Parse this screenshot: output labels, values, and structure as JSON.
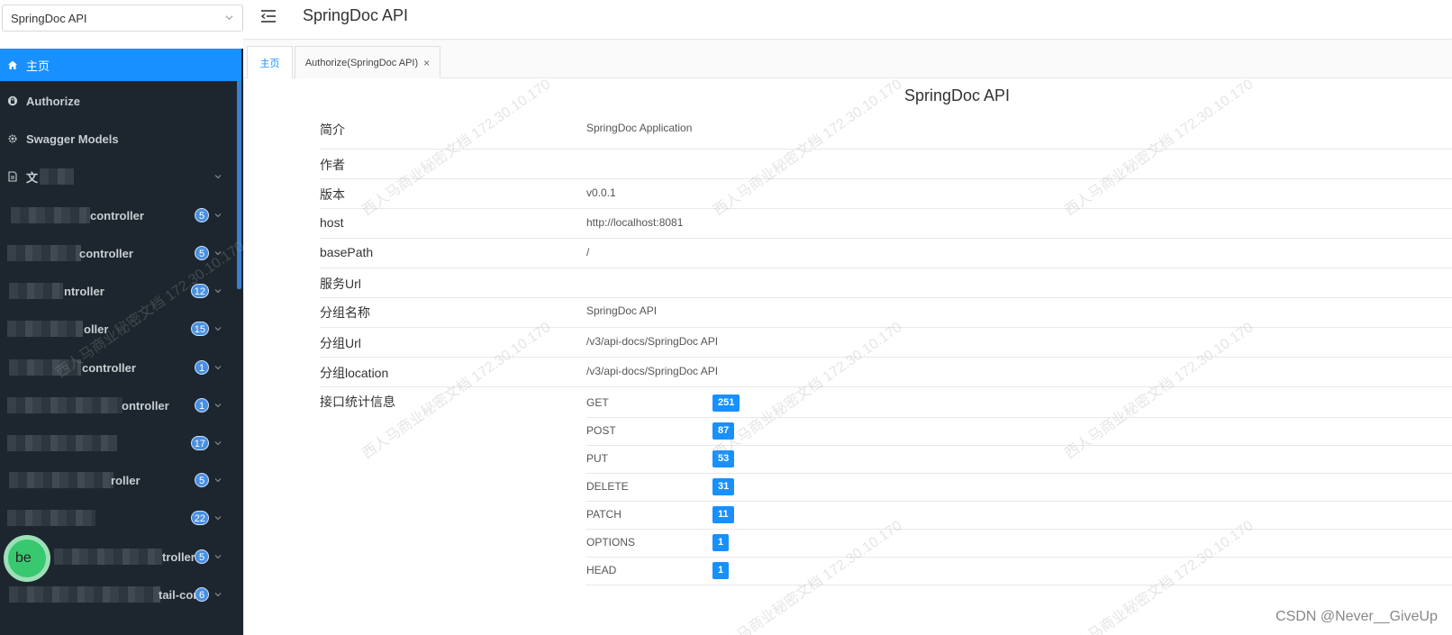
{
  "group_select": {
    "value": "SpringDoc API"
  },
  "menu": {
    "items": [
      {
        "label": "主页",
        "icon": "home-icon",
        "active": true
      },
      {
        "label": "Authorize",
        "icon": "lock-icon"
      },
      {
        "label": "Swagger Models",
        "icon": "gear-icon"
      },
      {
        "label": "文",
        "icon": "document-icon"
      }
    ],
    "controllers": [
      {
        "label": "controller",
        "count": "5"
      },
      {
        "label": "controller",
        "count": "5"
      },
      {
        "label": "ntroller",
        "count": "12"
      },
      {
        "label": "oller",
        "count": "15"
      },
      {
        "label": "controller",
        "count": "1"
      },
      {
        "label": "ontroller",
        "count": "1"
      },
      {
        "label": "",
        "count": "17"
      },
      {
        "label": "roller",
        "count": "5"
      },
      {
        "label": "",
        "count": "22"
      },
      {
        "label": "troller",
        "count": "5"
      },
      {
        "label": "tail-contr",
        "count": "6"
      }
    ]
  },
  "header": {
    "title": "SpringDoc API"
  },
  "tabs": [
    {
      "label": "主页",
      "active": true
    },
    {
      "label": "Authorize(SpringDoc API)",
      "close": "×"
    }
  ],
  "doc": {
    "title": "SpringDoc API",
    "rows": [
      {
        "key": "简介",
        "value": "SpringDoc Application"
      },
      {
        "key": "作者",
        "value": ""
      },
      {
        "key": "版本",
        "value": "v0.0.1"
      },
      {
        "key": "host",
        "value": "http://localhost:8081"
      },
      {
        "key": "basePath",
        "value": "/"
      },
      {
        "key": "服务Url",
        "value": ""
      },
      {
        "key": "分组名称",
        "value": "SpringDoc API"
      },
      {
        "key": "分组Url",
        "value": "/v3/api-docs/SpringDoc API"
      },
      {
        "key": "分组location",
        "value": "/v3/api-docs/SpringDoc API"
      }
    ],
    "stats_label": "接口统计信息",
    "methods": [
      {
        "method": "GET",
        "count": "251"
      },
      {
        "method": "POST",
        "count": "87"
      },
      {
        "method": "PUT",
        "count": "53"
      },
      {
        "method": "DELETE",
        "count": "31"
      },
      {
        "method": "PATCH",
        "count": "11"
      },
      {
        "method": "OPTIONS",
        "count": "1"
      },
      {
        "method": "HEAD",
        "count": "1"
      }
    ]
  },
  "watermark": {
    "text": "西人马商业秘密文档 172.30.10.170"
  },
  "overlay": {
    "avatar_text": "be",
    "credit": "CSDN @Never__GiveUp"
  },
  "colors": {
    "accent": "#1890ff",
    "sidebar_bg": "#1d262e"
  }
}
